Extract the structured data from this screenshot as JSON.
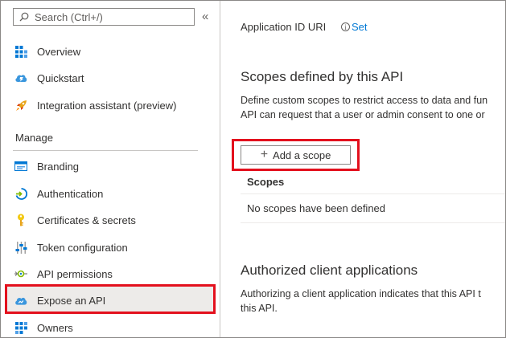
{
  "sidebar": {
    "search_placeholder": "Search (Ctrl+/)",
    "collapse_glyph": "«",
    "items_top": [
      {
        "label": "Overview",
        "icon": "overview-grid-icon"
      },
      {
        "label": "Quickstart",
        "icon": "quickstart-cloud-icon"
      },
      {
        "label": "Integration assistant (preview)",
        "icon": "rocket-icon"
      }
    ],
    "manage_header": "Manage",
    "items_manage": [
      {
        "label": "Branding",
        "icon": "branding-icon"
      },
      {
        "label": "Authentication",
        "icon": "authentication-icon"
      },
      {
        "label": "Certificates & secrets",
        "icon": "key-icon"
      },
      {
        "label": "Token configuration",
        "icon": "token-sliders-icon"
      },
      {
        "label": "API permissions",
        "icon": "api-permissions-icon"
      },
      {
        "label": "Expose an API",
        "icon": "expose-api-cloud-icon",
        "selected": true
      },
      {
        "label": "Owners",
        "icon": "owners-grid-icon"
      }
    ]
  },
  "main": {
    "app_id_uri_label": "Application ID URI",
    "set_link": "Set",
    "scopes_title": "Scopes defined by this API",
    "scopes_desc_line1": "Define custom scopes to restrict access to data and fun",
    "scopes_desc_line2": "API can request that a user or admin consent to one or",
    "add_scope_label": "Add a scope",
    "scopes_column": "Scopes",
    "empty_scopes": "No scopes have been defined",
    "auth_clients_title": "Authorized client applications",
    "auth_desc_line1": "Authorizing a client application indicates that this API t",
    "auth_desc_line2": "this API."
  },
  "colors": {
    "accent": "#0078d4",
    "highlight_red": "#e3101d",
    "selected_bg": "#edebe9"
  }
}
